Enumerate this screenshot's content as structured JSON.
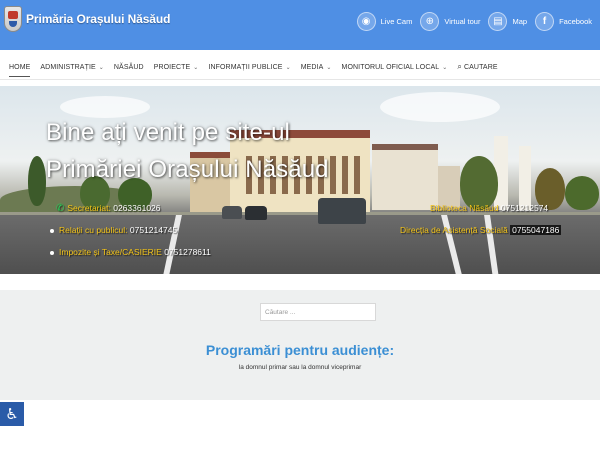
{
  "header": {
    "site_title": "Primăria Orașului Năsăud",
    "links": [
      {
        "label": "Live Cam",
        "icon": "camera-icon",
        "glyph": "◉"
      },
      {
        "label": "Virtual tour",
        "icon": "globe-icon",
        "glyph": "⊕"
      },
      {
        "label": "Map",
        "icon": "map-icon",
        "glyph": "▤"
      },
      {
        "label": "Facebook",
        "icon": "facebook-icon",
        "glyph": "f"
      }
    ],
    "color": "#4f8fe4"
  },
  "nav": {
    "items": [
      {
        "label": "HOME",
        "dropdown": false,
        "active": true
      },
      {
        "label": "ADMINISTRAȚIE",
        "dropdown": true
      },
      {
        "label": "NĂSĂUD",
        "dropdown": false
      },
      {
        "label": "PROIECTE",
        "dropdown": true
      },
      {
        "label": "INFORMAȚII PUBLICE",
        "dropdown": true
      },
      {
        "label": "MEDIA",
        "dropdown": true
      },
      {
        "label": "MONITORUL OFICIAL LOCAL",
        "dropdown": true
      }
    ],
    "search_label": "CAUTARE"
  },
  "hero": {
    "title_line1": "Bine ați venit pe site-ul",
    "title_line2": "Primăriei Orașului Năsăud",
    "contacts": {
      "secretariat_label": "Secretariat:",
      "secretariat_phone": "0263361026",
      "relatii_label": "Relații cu publicul:",
      "relatii_phone": "0751214745",
      "impozite_label": "Impozite și Taxe/CASIERIE",
      "impozite_phone": "0751278611",
      "biblioteca_label": "Biblioteca Năsăud",
      "biblioteca_phone": "0751212574",
      "asistenta_label": "Direcția de Asistență Socială",
      "asistenta_phone": "0755047186"
    }
  },
  "content": {
    "search_placeholder": "Căutare ...",
    "programari_title": "Programări pentru audiențe:",
    "programari_subtitle": "la domnul primar sau la domnul viceprimar"
  },
  "accessibility": {
    "icon": "wheelchair-icon",
    "glyph": "♿"
  }
}
